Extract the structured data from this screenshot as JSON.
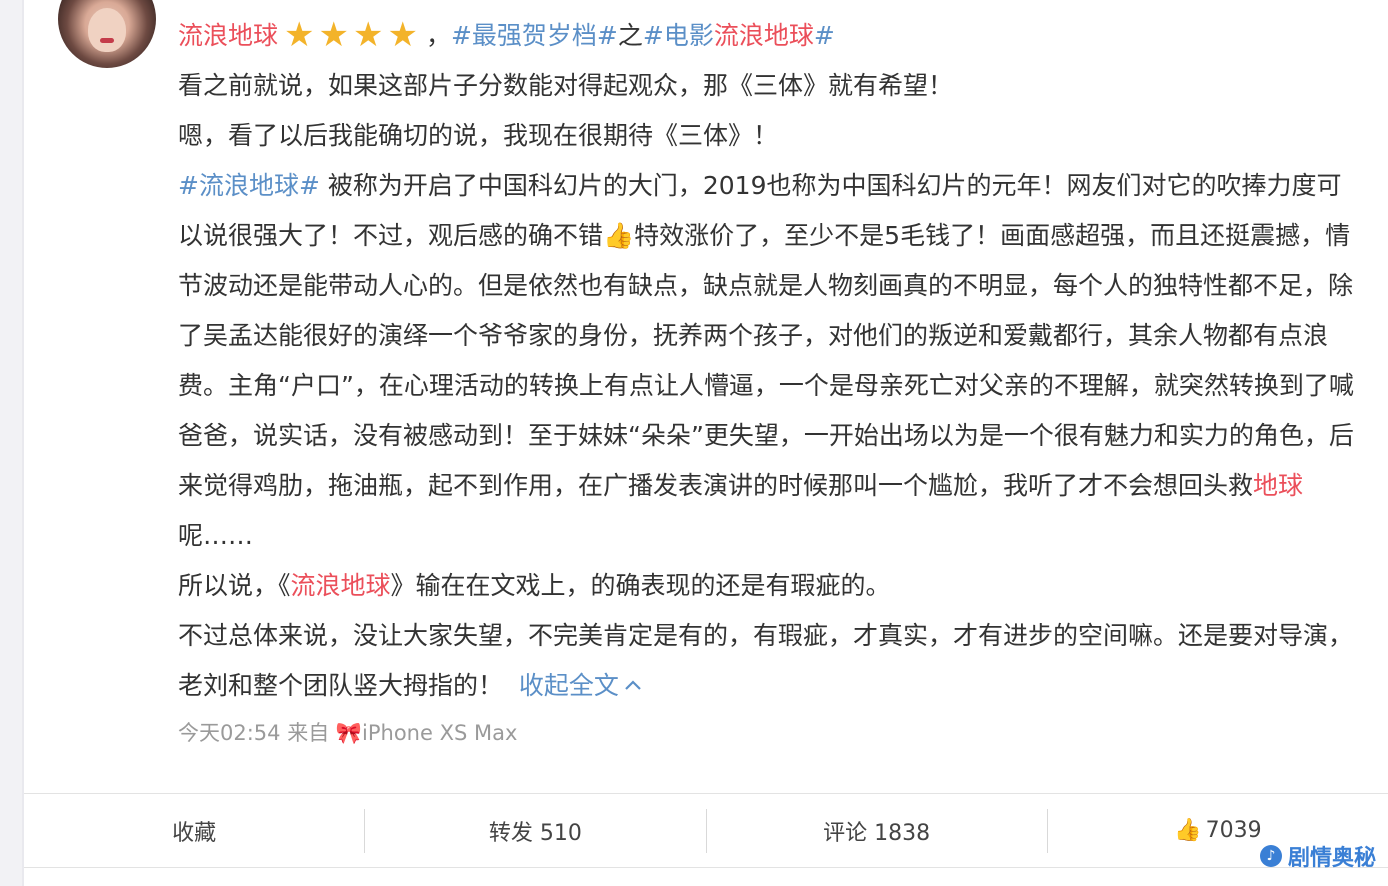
{
  "post": {
    "username": "流浪地球",
    "stars": "★★★★",
    "comma": "，",
    "topic1": "#最强贺岁档#",
    "zhi": "之",
    "topic2_pre": "#电影",
    "topic2_name": "流浪地球",
    "topic2_post": "#",
    "line1": "看之前就说，如果这部片子分数能对得起观众，那《三体》就有希望！",
    "line2": "嗯，看了以后我能确切的说，我现在很期待《三体》！",
    "p3_topic": "#流浪地球#",
    "p3_a": " 被称为开启了中国科幻片的大门，2019也称为中国科幻片的元年！网友们对它的吹捧力度可以说很强大了！不过，观后感的确不错",
    "p3_emoji": "👍",
    "p3_b": "特效涨价了，至少不是5毛钱了！画面感超强，而且还挺震撼，情节波动还是能带动人心的。但是依然也有缺点，缺点就是人物刻画真的不明显，每个人的独特性都不足，除了吴孟达能很好的演绎一个爷爷家的身份，抚养两个孩子，对他们的叛逆和爱戴都行，其余人物都有点浪费。主角“户口”，在心理活动的转换上有点让人懵逼，一个是母亲死亡对父亲的不理解，就突然转换到了喊爸爸，说实话，没有被感动到！至于妹妹“朵朵”更失望，一开始出场以为是一个很有魅力和实力的角色，后来觉得鸡肋，拖油瓶，起不到作用，在广播发表演讲的时候那叫一个尴尬，我听了才不会想回头救",
    "p3_red": "地球",
    "p3_c": "呢……",
    "p4_a": "所以说，《",
    "p4_red": "流浪地球",
    "p4_b": "》输在在文戏上，的确表现的还是有瑕疵的。",
    "p5": "不过总体来说，没让大家失望，不完美肯定是有的，有瑕疵，才真实，才有进步的空间嘛。还是要对导演，老刘和整个团队竖大拇指的！",
    "collapse": "收起全文",
    "collapse_icon": "chevron-up-icon",
    "time": "今天02:54 来自 ",
    "device_icon": "🎀",
    "device": "iPhone XS Max"
  },
  "actions": {
    "favorite": "收藏",
    "repost": "转发 510",
    "comment": "评论 1838",
    "like_icon": "👍",
    "like_count": "7039"
  },
  "watermark": {
    "text": "剧情奥秘",
    "icon": "audio-logo-icon"
  },
  "colors": {
    "name_red": "#eb4f5a",
    "topic_blue": "#5b8fc7",
    "star_gold": "#f3b32a"
  }
}
